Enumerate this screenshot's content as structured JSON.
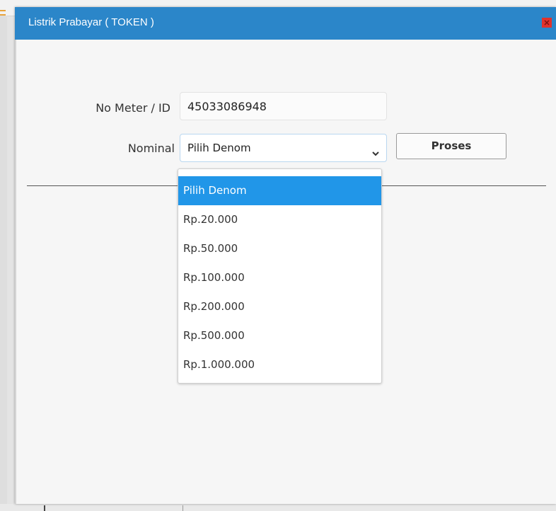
{
  "dialog": {
    "title": "Listrik Prabayar ( TOKEN )",
    "close_icon": "close-icon"
  },
  "form": {
    "meter_label": "No Meter / ID",
    "meter_value": "45033086948",
    "nominal_label": "Nominal",
    "nominal_selected": "Pilih Denom",
    "proses_label": "Proses"
  },
  "dropdown": {
    "options": [
      {
        "label": "Pilih Denom",
        "selected": true
      },
      {
        "label": "Rp.20.000",
        "selected": false
      },
      {
        "label": "Rp.50.000",
        "selected": false
      },
      {
        "label": "Rp.100.000",
        "selected": false
      },
      {
        "label": "Rp.200.000",
        "selected": false
      },
      {
        "label": "Rp.500.000",
        "selected": false
      },
      {
        "label": "Rp.1.000.000",
        "selected": false
      }
    ]
  },
  "colors": {
    "titlebar": "#2b86c9",
    "close_button": "#e0322c",
    "option_highlight": "#2196e8"
  }
}
